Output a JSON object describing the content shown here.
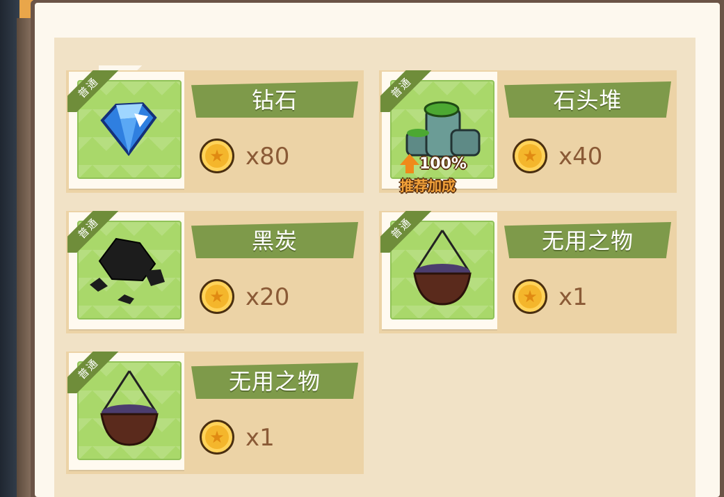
{
  "items": [
    {
      "name": "钻石",
      "tag": "普通",
      "quantity": "x80",
      "icon": "diamond-icon",
      "boost": null
    },
    {
      "name": "石头堆",
      "tag": "普通",
      "quantity": "x40",
      "icon": "stone-pile-icon",
      "boost": {
        "percent": "100%",
        "label": "推荐加成"
      }
    },
    {
      "name": "黑炭",
      "tag": "普通",
      "quantity": "x20",
      "icon": "charcoal-icon",
      "boost": null
    },
    {
      "name": "无用之物",
      "tag": "普通",
      "quantity": "x1",
      "icon": "basket-icon",
      "boost": null
    },
    {
      "name": "无用之物",
      "tag": "普通",
      "quantity": "x1",
      "icon": "basket-icon",
      "boost": null
    }
  ],
  "colors": {
    "card": "#ecd3a6",
    "name_bar": "#7e9a4a",
    "thumb": "#a9d86a",
    "coin": "#f4b62c",
    "quantity_text": "#8a5a36"
  }
}
